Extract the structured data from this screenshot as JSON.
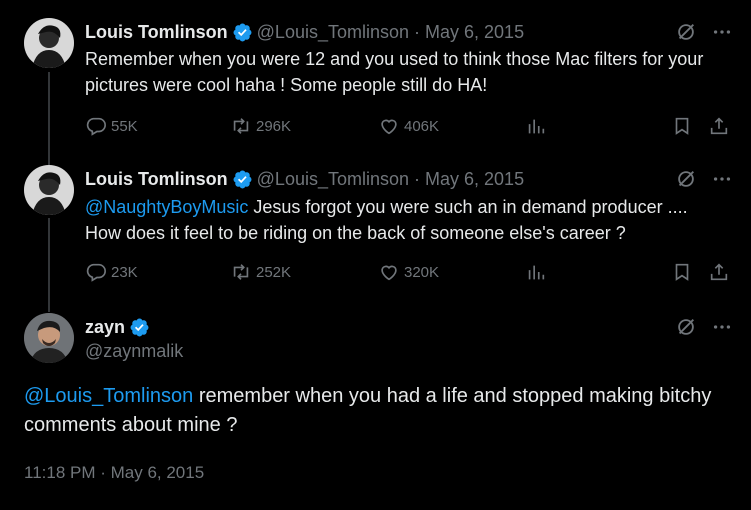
{
  "tweets": [
    {
      "author_name": "Louis Tomlinson",
      "handle": "@Louis_Tomlinson",
      "separator": "·",
      "date": "May 6, 2015",
      "text": "Remember when you were 12 and you used to think those Mac filters for your pictures were cool haha ! Some people still do HA!",
      "replies": "55K",
      "retweets": "296K",
      "likes": "406K"
    },
    {
      "author_name": "Louis Tomlinson",
      "handle": "@Louis_Tomlinson",
      "separator": "·",
      "date": "May 6, 2015",
      "mention": "@NaughtyBoyMusic",
      "text": " Jesus forgot you were such an in demand producer .... How does it feel to be riding on the back of someone else's career ?",
      "replies": "23K",
      "retweets": "252K",
      "likes": "320K"
    }
  ],
  "main_tweet": {
    "author_name": "zayn",
    "handle": "@zaynmalik",
    "mention": "@Louis_Tomlinson",
    "text": " remember when you had a life and stopped making bitchy comments about mine ?",
    "timestamp": "11:18 PM · May 6, 2015"
  },
  "colors": {
    "background": "#000000",
    "text": "#e7e9ea",
    "muted": "#71767b",
    "accent": "#1d9bf0",
    "thread_line": "#333639"
  },
  "icons": [
    "verified-badge-icon",
    "grok-icon",
    "more-icon",
    "reply-icon",
    "retweet-icon",
    "like-icon",
    "analytics-icon",
    "bookmark-icon",
    "share-icon"
  ]
}
